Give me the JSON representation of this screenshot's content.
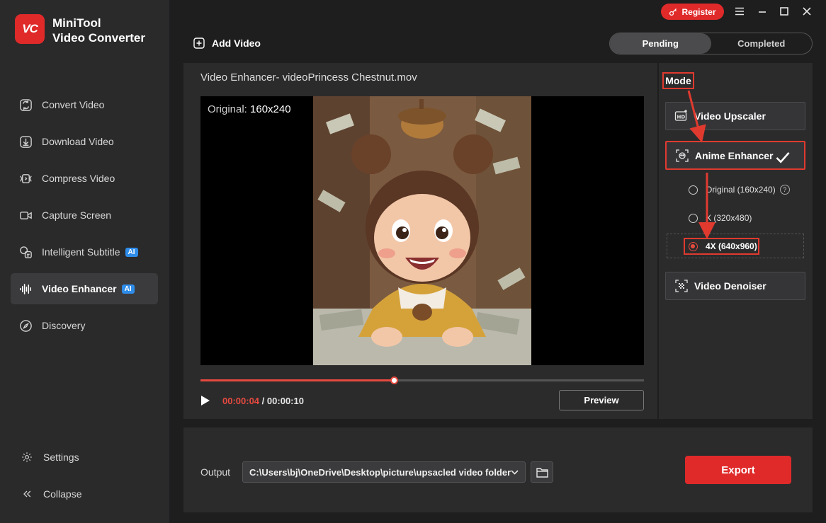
{
  "app": {
    "logo_text": "VC",
    "name_line1": "MiniTool",
    "name_line2": "Video Converter"
  },
  "titlebar": {
    "register_label": "Register"
  },
  "sidebar": {
    "items": [
      {
        "label": "Convert Video",
        "icon": "convert-icon"
      },
      {
        "label": "Download Video",
        "icon": "download-icon"
      },
      {
        "label": "Compress Video",
        "icon": "compress-icon"
      },
      {
        "label": "Capture Screen",
        "icon": "camera-icon"
      },
      {
        "label": "Intelligent Subtitle",
        "icon": "subtitle-icon",
        "badge": "AI"
      },
      {
        "label": "Video Enhancer",
        "icon": "waveform-icon",
        "badge": "AI",
        "active": true
      },
      {
        "label": "Discovery",
        "icon": "compass-icon"
      }
    ],
    "settings_label": "Settings",
    "collapse_label": "Collapse"
  },
  "toolbar": {
    "add_video_label": "Add Video",
    "tabs": [
      {
        "label": "Pending",
        "active": true
      },
      {
        "label": "Completed",
        "active": false
      }
    ]
  },
  "player": {
    "title": "Video Enhancer- videoPrincess Chestnut.mov",
    "original_prefix": "Original:",
    "original_size": "160x240",
    "current_time": "00:00:04",
    "separator": "/",
    "total_time": "00:00:10",
    "progress_fraction": 0.436,
    "preview_label": "Preview"
  },
  "mode": {
    "label": "Mode",
    "options": [
      {
        "label": "Video Upscaler",
        "icon": "hd-icon"
      },
      {
        "label": "Anime Enhancer",
        "icon": "anime-icon",
        "selected": true
      },
      {
        "label": "Video Denoiser",
        "icon": "denoise-icon"
      }
    ],
    "scales": [
      {
        "label": "Original (160x240)",
        "checked": false,
        "help": "?"
      },
      {
        "label": "X (320x480)",
        "checked": false
      },
      {
        "label": "4X (640x960)",
        "checked": true
      }
    ]
  },
  "output": {
    "label": "Output",
    "path": "C:\\Users\\bj\\OneDrive\\Desktop\\picture\\upsacled video folder",
    "export_label": "Export"
  },
  "colors": {
    "accent": "#e02a2a",
    "annotation": "#e03a2f",
    "ai_badge": "#2f8dea"
  }
}
